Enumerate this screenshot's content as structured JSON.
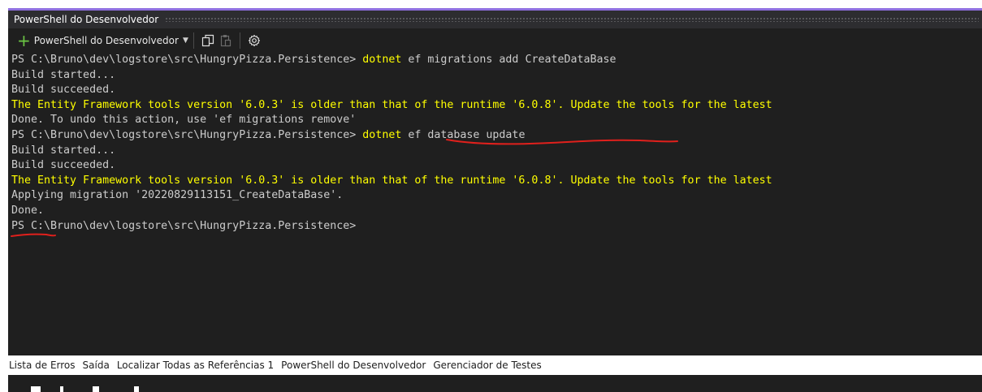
{
  "window": {
    "title": "PowerShell do Desenvolvedor"
  },
  "toolbar": {
    "new_terminal_label": "PowerShell do Desenvolvedor",
    "icons": [
      "plus-icon",
      "chevron-down-icon",
      "copy-icon",
      "paste-icon",
      "gear-icon"
    ]
  },
  "console": {
    "lines": [
      {
        "prompt": "PS C:\\Bruno\\dev\\logstore\\src\\HungryPizza.Persistence> ",
        "command": "dotnet",
        "rest": " ef migrations add CreateDataBase"
      },
      {
        "text": "Build started..."
      },
      {
        "text": "Build succeeded."
      },
      {
        "warning": "The Entity Framework tools version '6.0.3' is older than that of the runtime '6.0.8'. Update the tools for the latest"
      },
      {
        "text": "Done. To undo this action, use 'ef migrations remove'"
      },
      {
        "prompt": "PS C:\\Bruno\\dev\\logstore\\src\\HungryPizza.Persistence> ",
        "command": "dotnet",
        "rest": " ef database update"
      },
      {
        "text": "Build started..."
      },
      {
        "text": "Build succeeded."
      },
      {
        "warning": "The Entity Framework tools version '6.0.3' is older than that of the runtime '6.0.8'. Update the tools for the latest"
      },
      {
        "text": "Applying migration '20220829113151_CreateDataBase'."
      },
      {
        "text": "Done."
      },
      {
        "prompt": "PS C:\\Bruno\\dev\\logstore\\src\\HungryPizza.Persistence>"
      }
    ]
  },
  "bottom_tabs": [
    "Lista de Erros",
    "Saída",
    "Localizar Todas as Referências 1",
    "PowerShell do Desenvolvedor",
    "Gerenciador de Testes"
  ],
  "colors": {
    "accent": "#8f6fe0",
    "console_bg": "#1f1f1f",
    "console_text": "#cccccc",
    "command": "#ffff00",
    "warning": "#ffff00",
    "annotation": "#e0201c"
  }
}
